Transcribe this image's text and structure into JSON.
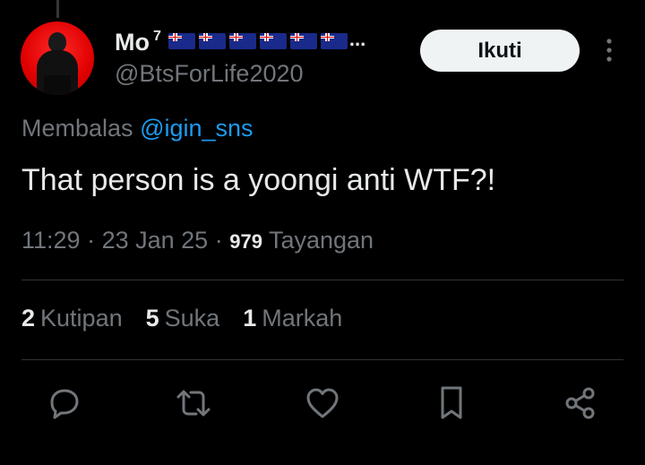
{
  "tweet": {
    "author": {
      "display_name": "Mo",
      "name_suffix": "7",
      "name_overflow": "...",
      "handle": "@BtsForLife2020",
      "flag_count": 6
    },
    "follow_label": "Ikuti",
    "reply_prefix": "Membalas",
    "reply_mention": "@igin_sns",
    "text": "That person is a yoongi anti WTF?!",
    "time": "11:29",
    "separator": "·",
    "date": "23 Jan 25",
    "views_count": "979",
    "views_label": "Tayangan"
  },
  "stats": [
    {
      "count": "2",
      "label": "Kutipan"
    },
    {
      "count": "5",
      "label": "Suka"
    },
    {
      "count": "1",
      "label": "Markah"
    }
  ],
  "actions": [
    "reply-icon",
    "retweet-icon",
    "like-icon",
    "bookmark-icon",
    "share-icon"
  ],
  "colors": {
    "background": "#000000",
    "text": "#e7e9ea",
    "muted": "#71767b",
    "link": "#1d9bf0",
    "button_bg": "#eff3f4"
  }
}
